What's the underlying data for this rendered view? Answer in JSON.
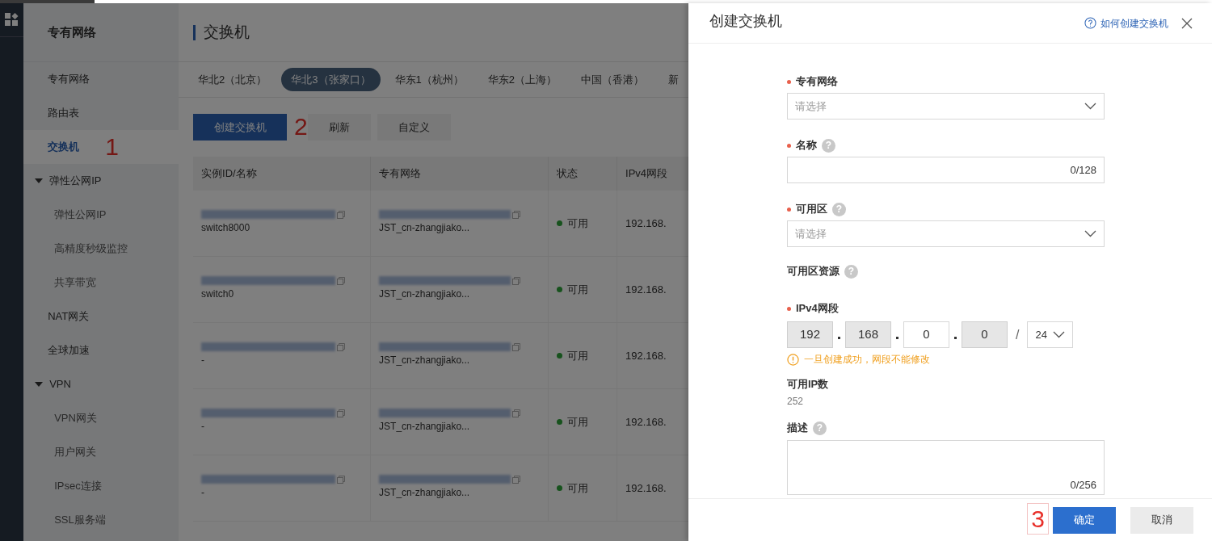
{
  "page_title": "交换机",
  "sidebar": {
    "title": "专有网络",
    "items": [
      {
        "label": "专有网络",
        "selected": false
      },
      {
        "label": "路由表",
        "selected": false
      },
      {
        "label": "交换机",
        "selected": true,
        "annotation": "1"
      },
      {
        "label": "弹性公网IP",
        "selected": false,
        "expanded": true,
        "children": [
          {
            "label": "弹性公网IP",
            "selected": false
          },
          {
            "label": "高精度秒级监控",
            "selected": false
          },
          {
            "label": "共享带宽",
            "selected": false
          }
        ]
      },
      {
        "label": "NAT网关",
        "selected": false
      },
      {
        "label": "全球加速",
        "selected": false
      },
      {
        "label": "VPN",
        "selected": false,
        "expanded": true,
        "children": [
          {
            "label": "VPN网关",
            "selected": false
          },
          {
            "label": "用户网关",
            "selected": false
          },
          {
            "label": "IPsec连接",
            "selected": false
          },
          {
            "label": "SSL服务端",
            "selected": false
          }
        ]
      }
    ]
  },
  "region_tabs": [
    {
      "label": "华北2（北京）",
      "selected": false
    },
    {
      "label": "华北3（张家口）",
      "selected": true
    },
    {
      "label": "华东1（杭州）",
      "selected": false
    },
    {
      "label": "华东2（上海）",
      "selected": false
    },
    {
      "label": "中国（香港）",
      "selected": false
    },
    {
      "label": "新",
      "selected": false
    }
  ],
  "toolbar": [
    {
      "label": "创建交换机",
      "kind": "primary",
      "annotation": "2"
    },
    {
      "label": "刷新",
      "kind": "secondary"
    },
    {
      "label": "自定义",
      "kind": "secondary"
    }
  ],
  "table": {
    "columns": [
      "实例ID/名称",
      "专有网络",
      "状态",
      "IPv4网段"
    ],
    "rows": [
      {
        "name": "switch8000",
        "vpc": "JST_cn-zhangjiako...",
        "status": "可用",
        "ipv4": "192.168."
      },
      {
        "name": "switch0",
        "vpc": "JST_cn-zhangjiako...",
        "status": "可用",
        "ipv4": "192.168."
      },
      {
        "name": "-",
        "vpc": "JST_cn-zhangjiako...",
        "status": "可用",
        "ipv4": "192.168."
      },
      {
        "name": "-",
        "vpc": "JST_cn-zhangjiako...",
        "status": "可用",
        "ipv4": "192.168."
      },
      {
        "name": "-",
        "vpc": "JST_cn-zhangjiako...",
        "status": "可用",
        "ipv4": "192.168."
      }
    ]
  },
  "drawer": {
    "title": "创建交换机",
    "help_link": "如何创建交换机",
    "fields": [
      {
        "kind": "select",
        "label": "专有网络",
        "required": true,
        "placeholder": "请选择"
      },
      {
        "kind": "text",
        "label": "名称",
        "required": true,
        "help": "?",
        "counter": "0/128"
      },
      {
        "kind": "select",
        "label": "可用区",
        "required": true,
        "help": "?",
        "placeholder": "请选择"
      },
      {
        "kind": "info",
        "label": "可用区资源",
        "required": false,
        "help": "?"
      },
      {
        "kind": "ip",
        "label": "IPv4网段",
        "required": true,
        "octets": [
          {
            "value": "192",
            "disabled": true
          },
          {
            "value": "168",
            "disabled": true
          },
          {
            "value": "0",
            "disabled": false
          },
          {
            "value": "0",
            "disabled": true
          }
        ],
        "separator": "/",
        "mask": "24",
        "warning": "一旦创建成功，网段不能修改"
      },
      {
        "kind": "readonly",
        "label": "可用IP数",
        "required": false,
        "value": "252"
      },
      {
        "kind": "textarea",
        "label": "描述",
        "required": false,
        "help": "?",
        "counter": "0/256"
      }
    ],
    "buttons": [
      {
        "label": "确定",
        "kind": "primary",
        "annotation": "3"
      },
      {
        "label": "取消",
        "kind": "secondary"
      }
    ]
  }
}
